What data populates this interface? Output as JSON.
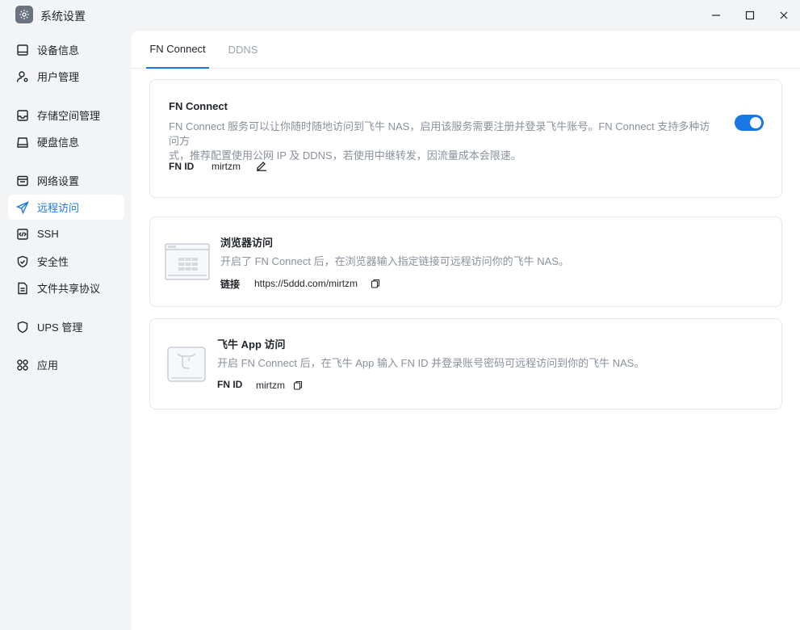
{
  "window": {
    "title": "系统设置",
    "app_icon": "gear-icon",
    "controls": [
      "minimize-icon",
      "maximize-icon",
      "close-icon"
    ]
  },
  "sidebar": {
    "items": [
      {
        "label": "设备信息",
        "icon": "monitor-icon"
      },
      {
        "label": "用户管理",
        "icon": "user-gear-icon"
      },
      {
        "label": "存储空间管理",
        "icon": "storage-icon"
      },
      {
        "label": "硬盘信息",
        "icon": "disk-icon"
      },
      {
        "label": "网络设置",
        "icon": "network-icon"
      },
      {
        "label": "远程访问",
        "icon": "send-icon",
        "active": true
      },
      {
        "label": "SSH",
        "icon": "code-icon"
      },
      {
        "label": "安全性",
        "icon": "shield-check-icon"
      },
      {
        "label": "文件共享协议",
        "icon": "file-icon"
      },
      {
        "label": "UPS 管理",
        "icon": "shield-icon"
      },
      {
        "label": "应用",
        "icon": "apps-icon"
      }
    ]
  },
  "tabs": [
    {
      "label": "FN Connect",
      "active": true
    },
    {
      "label": "DDNS",
      "active": false
    }
  ],
  "fn_connect": {
    "title": "FN Connect",
    "description_line1": "FN Connect 服务可以让你随时随地访问到飞牛 NAS，启用该服务需要注册并登录飞牛账号。FN Connect 支持多种访问方",
    "description_line2": "式，推荐配置使用公网 IP 及 DDNS，若使用中继转发，因流量成本会限速。",
    "fn_id_label": "FN ID",
    "fn_id_value": "mirtzm",
    "enabled": true
  },
  "browser_access": {
    "title": "浏览器访问",
    "description": "开启了 FN Connect 后，在浏览器输入指定链接可远程访问你的飞牛 NAS。",
    "link_label": "链接",
    "link_value": "https://5ddd.com/mirtzm"
  },
  "app_access": {
    "title": "飞牛 App 访问",
    "description": "开启 FN Connect 后，在飞牛 App 输入 FN ID 并登录账号密码可远程访问到你的飞牛 NAS。",
    "fn_id_label": "FN ID",
    "fn_id_value": "mirtzm"
  },
  "colors": {
    "accent": "#1677e5",
    "muted_text": "#8a919c",
    "sidebar_bg": "#f3f4f6"
  }
}
